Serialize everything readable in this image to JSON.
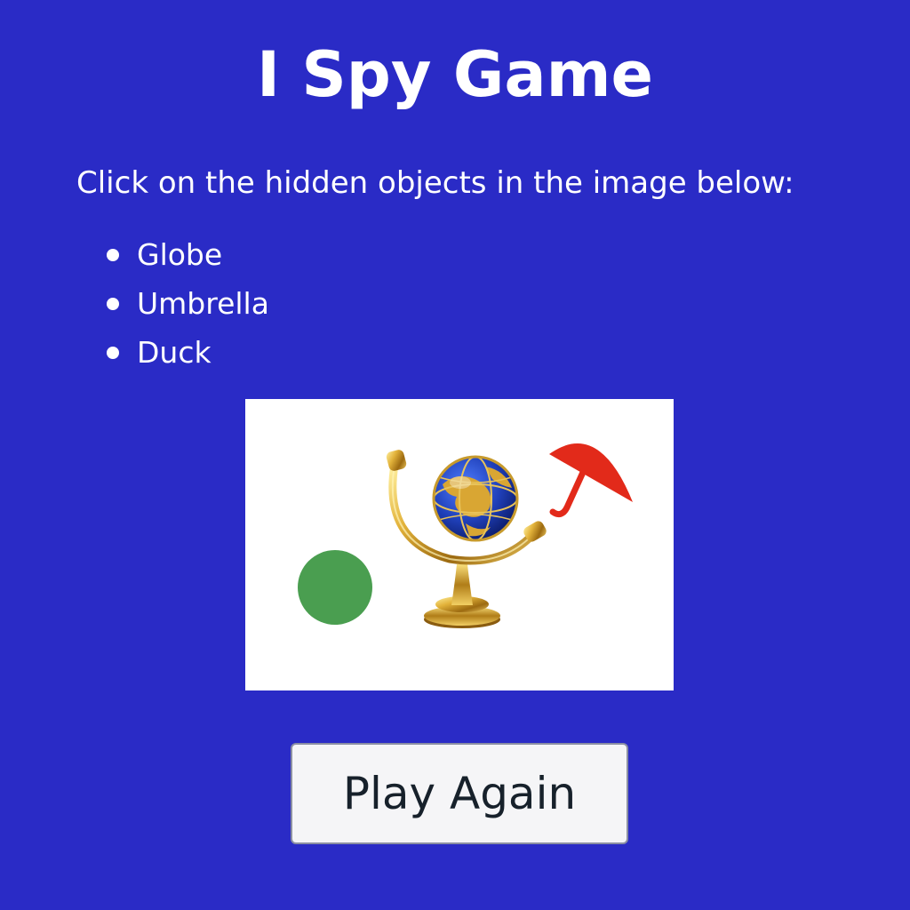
{
  "page": {
    "title": "I Spy Game",
    "instructions": "Click on the hidden objects in the image below:"
  },
  "objects": [
    {
      "label": "Globe"
    },
    {
      "label": "Umbrella"
    },
    {
      "label": "Duck"
    }
  ],
  "scene": {
    "background_color": "#ffffff",
    "items": [
      {
        "name": "globe",
        "icon": "globe-icon",
        "color": "#1f3fb8"
      },
      {
        "name": "umbrella",
        "icon": "umbrella-icon",
        "color": "#e22a1a"
      },
      {
        "name": "green-circle",
        "icon": "circle",
        "color": "#4a9e50"
      }
    ]
  },
  "buttons": {
    "play_again": "Play Again"
  },
  "colors": {
    "page_background": "#2a2bc6",
    "text": "#ffffff",
    "button_background": "#f5f5f7",
    "button_text": "#17212b"
  }
}
